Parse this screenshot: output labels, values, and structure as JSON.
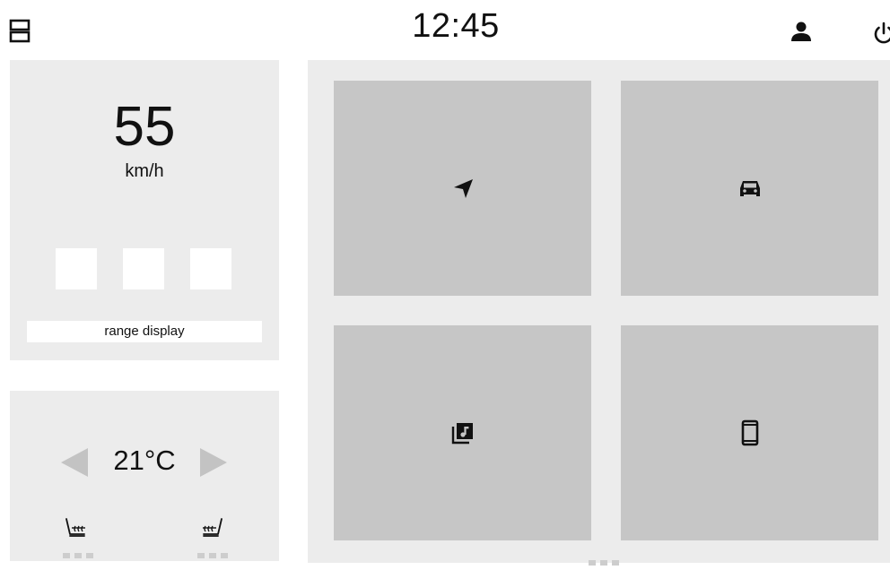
{
  "status_bar": {
    "time": "12:45",
    "icons": [
      "menu-icon",
      "user-icon",
      "power-icon"
    ]
  },
  "speed_panel": {
    "speed": "55",
    "unit": "km/h",
    "range_label": "range display",
    "quick_slots": 3
  },
  "climate_panel": {
    "temperature": "21°C",
    "icons": [
      "arrow-left-icon",
      "arrow-right-icon",
      "seat-heat-left-icon",
      "seat-heat-right-icon"
    ]
  },
  "tiles": [
    {
      "name": "navigation",
      "icon": "navigation-arrow-icon"
    },
    {
      "name": "vehicle",
      "icon": "car-icon"
    },
    {
      "name": "music",
      "icon": "music-library-icon"
    },
    {
      "name": "phone",
      "icon": "smartphone-icon"
    }
  ],
  "colors": {
    "panel": "#ececec",
    "tile": "#c6c6c6",
    "arrow": "#c3c3c3",
    "indicator": "#cdcdcd",
    "icon": "#111111"
  }
}
